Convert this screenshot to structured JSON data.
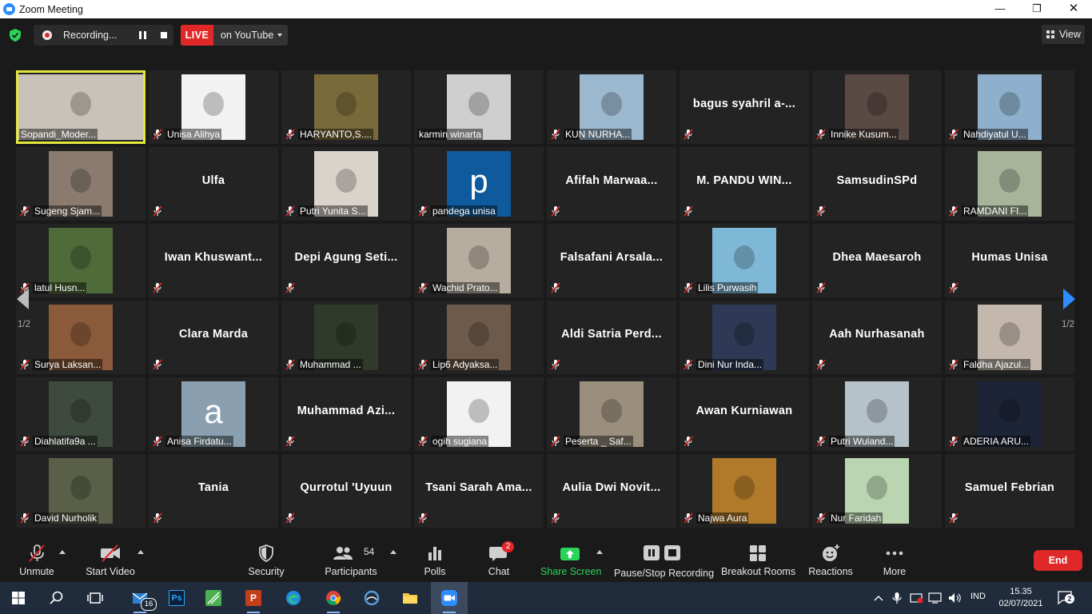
{
  "window": {
    "title": "Zoom Meeting"
  },
  "top": {
    "recording_label": "Recording...",
    "live_label": "LIVE",
    "stream_label": "on YouTube",
    "view_label": "View"
  },
  "participants": [
    {
      "name": "Sopandi_Moder...",
      "video": true,
      "bg": "#c9c2b8",
      "active": true,
      "muted": false
    },
    {
      "name": "Unisa Alihya",
      "video": true,
      "bg": "#f2f2f2"
    },
    {
      "name": "HARYANTO,S....",
      "video": true,
      "bg": "#7a6a3a"
    },
    {
      "name": "karmin winarta",
      "video": true,
      "bg": "#cfcfcf",
      "muted": false
    },
    {
      "name": "KUN NURHA...",
      "video": true,
      "bg": "#9bb8cf"
    },
    {
      "name": "bagus syahril a-...",
      "video": false
    },
    {
      "name": "Innike Kusum...",
      "video": true,
      "bg": "#5a4a44"
    },
    {
      "name": "Nahdiyatul U...",
      "video": true,
      "bg": "#8fb0cc"
    },
    {
      "name": "Sugeng Sjam...",
      "video": true,
      "bg": "#8a7b6e"
    },
    {
      "name": "Ulfa",
      "video": false
    },
    {
      "name": "Putri Yunita S...",
      "video": true,
      "bg": "#d9d3cb"
    },
    {
      "name": "pandega unisa",
      "video": true,
      "bg": "#0f5a9c",
      "letter": "p"
    },
    {
      "name": "Afifah Marwaa...",
      "video": false
    },
    {
      "name": "M. PANDU WIN...",
      "video": false
    },
    {
      "name": "SamsudinSPd",
      "video": false
    },
    {
      "name": "RAMDANI FI...",
      "video": true,
      "bg": "#a8b49a"
    },
    {
      "name": "latul Husn...",
      "video": true,
      "bg": "#4f6b3a"
    },
    {
      "name": "Iwan Khuswant...",
      "video": false
    },
    {
      "name": "Depi Agung Seti...",
      "video": false
    },
    {
      "name": "Wachid Prato...",
      "video": true,
      "bg": "#b7ad9e"
    },
    {
      "name": "Falsafani Arsala...",
      "video": false
    },
    {
      "name": "Lilis Purwasih",
      "video": true,
      "bg": "#7fb8d6"
    },
    {
      "name": "Dhea Maesaroh",
      "video": false
    },
    {
      "name": "Humas Unisa",
      "video": false
    },
    {
      "name": "Surya Laksan...",
      "video": true,
      "bg": "#8a5a3a"
    },
    {
      "name": "Clara Marda",
      "video": false
    },
    {
      "name": "Muhammad ...",
      "video": true,
      "bg": "#2f3a2a"
    },
    {
      "name": "Lip6 Adyaksa...",
      "video": true,
      "bg": "#6e5a4a"
    },
    {
      "name": "Aldi Satria Perd...",
      "video": false
    },
    {
      "name": "Dini Nur Inda...",
      "video": true,
      "bg": "#2e3a55"
    },
    {
      "name": "Aah Nurhasanah",
      "video": false
    },
    {
      "name": "Faldha Ajazul...",
      "video": true,
      "bg": "#c4b8ad"
    },
    {
      "name": "Diahlatifa9a ...",
      "video": true,
      "bg": "#3f4a3e"
    },
    {
      "name": "Anisa Firdatu...",
      "video": true,
      "bg": "#8aa0b0",
      "letter": "a"
    },
    {
      "name": "Muhammad Azi...",
      "video": false
    },
    {
      "name": "ogih sugiana",
      "video": true,
      "bg": "#f2f2f2"
    },
    {
      "name": "Peserta _ Saf...",
      "video": true,
      "bg": "#9a8e7c"
    },
    {
      "name": "Awan Kurniawan",
      "video": false
    },
    {
      "name": "Putri Wuland...",
      "video": true,
      "bg": "#b5c2c9"
    },
    {
      "name": "ADERIA ARU...",
      "video": true,
      "bg": "#1d2438"
    },
    {
      "name": "David Nurholik",
      "video": true,
      "bg": "#5a6048"
    },
    {
      "name": "Tania",
      "video": false
    },
    {
      "name": "Qurrotul 'Uyuun",
      "video": false
    },
    {
      "name": "Tsani Sarah Ama...",
      "video": false
    },
    {
      "name": "Aulia Dwi Novit...",
      "video": false
    },
    {
      "name": "Najwa Aura",
      "video": true,
      "bg": "#b07a2a"
    },
    {
      "name": "Nur Faridah",
      "video": true,
      "bg": "#b9d6b0"
    },
    {
      "name": "Samuel Febrian",
      "video": false
    }
  ],
  "pagination": {
    "left": "1/2",
    "right": "1/2"
  },
  "toolbar": {
    "unmute": "Unmute",
    "start_video": "Start Video",
    "security": "Security",
    "participants": "Participants",
    "participants_count": "54",
    "polls": "Polls",
    "chat": "Chat",
    "chat_badge": "2",
    "share_screen": "Share Screen",
    "pause_stop_recording": "Pause/Stop Recording",
    "breakout_rooms": "Breakout Rooms",
    "reactions": "Reactions",
    "more": "More",
    "end": "End"
  },
  "taskbar": {
    "mail_badge": "16",
    "lang": "IND",
    "time": "15.35",
    "date": "02/07/2021",
    "notif_count": "2",
    "apps": [
      "start-icon",
      "search-icon",
      "task-view-icon",
      "mail-icon",
      "photoshop-icon",
      "corel-icon",
      "powerpoint-icon",
      "edge-icon",
      "chrome-icon",
      "cortana-icon",
      "file-explorer-icon",
      "zoom-icon"
    ]
  },
  "colors": {
    "live_red": "#e02828",
    "active_speaker": "#e3e83b",
    "share_green": "#2bd35a",
    "end_red": "#e02828"
  }
}
